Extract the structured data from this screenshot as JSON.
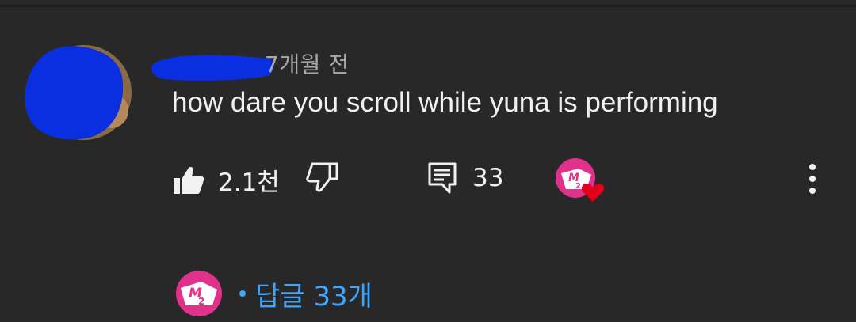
{
  "comment": {
    "timestamp": "7개월 전",
    "text": "how dare you scroll while yuna is performing",
    "like_count": "2.1천",
    "reply_count": "33",
    "icons": {
      "like": "thumbs-up-icon",
      "dislike": "thumbs-down-icon",
      "reply": "comment-icon",
      "creator_heart": "creator-heart-icon",
      "more": "more-vertical-icon"
    }
  },
  "replies": {
    "label": "답글 33개"
  },
  "colors": {
    "background": "#282828",
    "text": "#f1f1f1",
    "secondary_text": "#aaaaaa",
    "link": "#3ea6ff",
    "heart": "#e1001a",
    "brand_pink": "#e0328a",
    "redaction_blue": "#0a2fe0"
  }
}
